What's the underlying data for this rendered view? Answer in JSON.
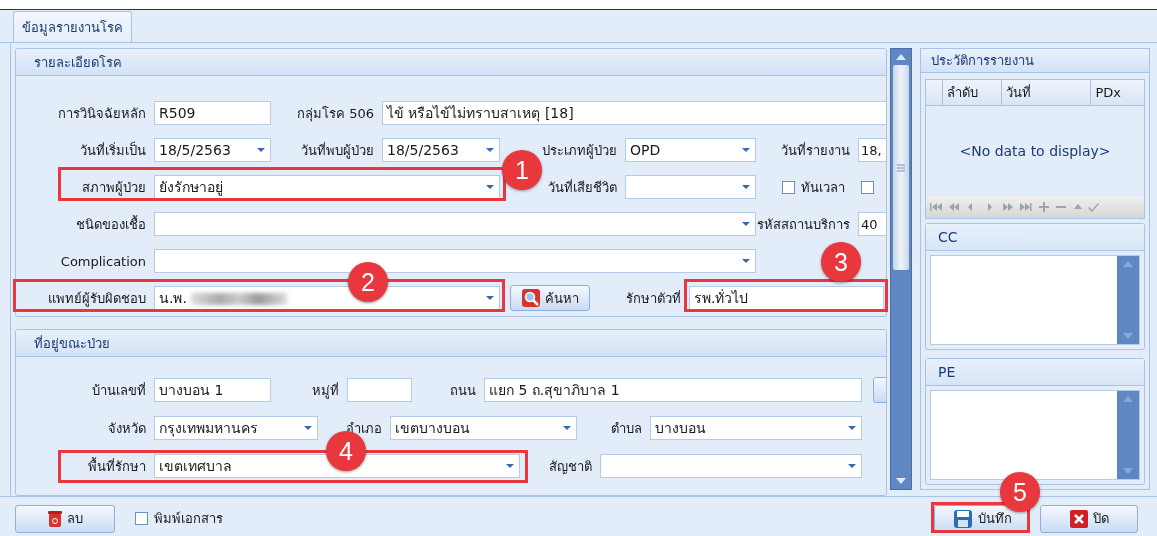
{
  "tabs": [
    {
      "label": "ข้อมูลรายงานโรค",
      "selected": true
    }
  ],
  "disease_details": {
    "title": "รายละเอียดโรค",
    "rows": [
      {
        "items": [
          {
            "kind": "text",
            "label": "การวินิจฉัยหลัก",
            "value": "R509"
          },
          {
            "kind": "text",
            "label": "กลุ่มโรค 506",
            "value": "ไข้ หรือไข้ไม่ทราบสาเหตุ [18]"
          }
        ]
      },
      {
        "items": [
          {
            "kind": "combo",
            "label": "วันที่เริ่มเป็น",
            "value": "18/5/2563"
          },
          {
            "kind": "combo",
            "label": "วันที่พบผู้ป่วย",
            "value": "18/5/2563"
          },
          {
            "kind": "combo",
            "label": "ประเภทผู้ป่วย",
            "value": "OPD"
          },
          {
            "kind": "text",
            "label": "วันที่รายงาน",
            "value": "18,"
          }
        ]
      },
      {
        "items": [
          {
            "kind": "combo",
            "label": "สภาพผู้ป่วย",
            "value": "ยังรักษาอยู่"
          },
          {
            "kind": "combo",
            "label": "วันที่เสียชีวิต"
          },
          {
            "kind": "check",
            "label": "ทันเวลา",
            "checked": false
          },
          {
            "kind": "check",
            "checked": false
          }
        ]
      },
      {
        "items": [
          {
            "kind": "combo",
            "label": "ชนิดของเชื้อ"
          },
          {
            "kind": "text",
            "label": "รหัสสถานบริการ",
            "value": "40"
          }
        ]
      },
      {
        "items": [
          {
            "kind": "combo",
            "label": "Complication"
          }
        ]
      },
      {
        "items": [
          {
            "kind": "combo",
            "label": "แพทย์ผู้รับผิดชอบ",
            "value": "น.พ.",
            "blurred": true
          },
          {
            "kind": "button",
            "label": "ค้นหา"
          },
          {
            "kind": "text",
            "label": "รักษาตัวที่",
            "value": "รพ.ทั่วไป"
          }
        ]
      }
    ]
  },
  "address": {
    "title": "ที่อยู่ขณะป่วย",
    "rows": [
      {
        "items": [
          {
            "kind": "text",
            "label": "บ้านเลขที่",
            "value": "บางบอน 1"
          },
          {
            "kind": "text",
            "label": "หมู่ที่"
          },
          {
            "kind": "text",
            "label": "ถนน",
            "value": "แยก 5 ถ.สุขาภิบาล 1"
          },
          {
            "kind": "button"
          }
        ]
      },
      {
        "items": [
          {
            "kind": "combo",
            "label": "จังหวัด",
            "value": "กรุงเทพมหานคร"
          },
          {
            "kind": "combo",
            "label": "อำเภอ",
            "value": "เขตบางบอน"
          },
          {
            "kind": "combo",
            "label": "ตำบล",
            "value": "บางบอน"
          }
        ]
      },
      {
        "items": [
          {
            "kind": "combo",
            "label": "พื้นที่รักษา",
            "value": "เขตเทศบาล"
          },
          {
            "kind": "combo",
            "label": "สัญชาติ"
          }
        ]
      }
    ]
  },
  "history": {
    "title": "ประวัติการรายงาน",
    "columns": [
      "ลำดับ",
      "วันที่",
      "PDx"
    ],
    "empty_text": "<No data to display>"
  },
  "cc": {
    "title": "CC"
  },
  "pe": {
    "title": "PE"
  },
  "footer": {
    "delete_button": "ลบ",
    "print_checkbox": {
      "label": "พิมพ์เอกสาร",
      "checked": false
    },
    "save_button": "บันทึก",
    "close_button": "ปิด"
  },
  "annotations": [
    {
      "number": "1"
    },
    {
      "number": "2"
    },
    {
      "number": "3"
    },
    {
      "number": "4"
    },
    {
      "number": "5"
    }
  ]
}
